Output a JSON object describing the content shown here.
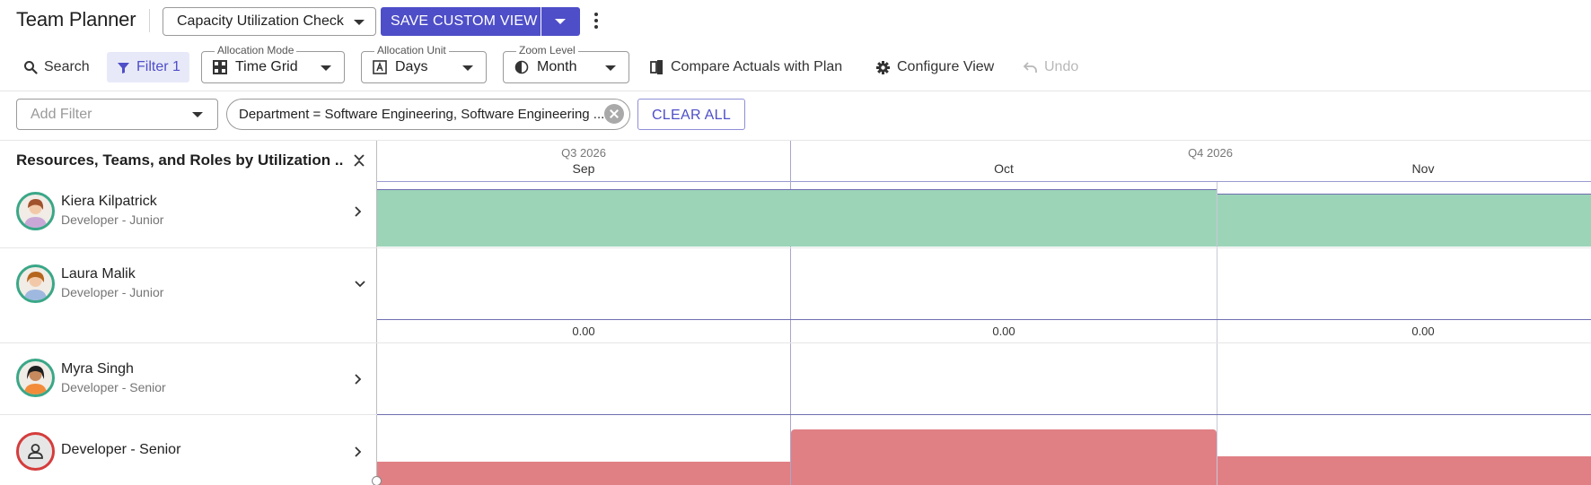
{
  "app": {
    "title": "Team Planner",
    "view_name": "Capacity Utilization Check",
    "save_label": "SAVE CUSTOM VIEW"
  },
  "toolbar": {
    "search_label": "Search",
    "filter_label": "Filter 1",
    "allocation_mode": {
      "label": "Allocation Mode",
      "value": "Time Grid"
    },
    "allocation_unit": {
      "label": "Allocation Unit",
      "value": "Days"
    },
    "zoom_level": {
      "label": "Zoom Level",
      "value": "Month"
    },
    "compare_label": "Compare Actuals with Plan",
    "configure_label": "Configure View",
    "undo_label": "Undo"
  },
  "filters": {
    "add_placeholder": "Add Filter",
    "chip_text": "Department = Software Engineering, Software Engineering ...",
    "clear_label": "CLEAR ALL"
  },
  "grid": {
    "left_header": "Resources, Teams, and Roles by Utilization ...",
    "quarters": [
      "Q3 2026",
      "Q4 2026"
    ],
    "months": [
      "Sep",
      "Oct",
      "Nov"
    ]
  },
  "resources": [
    {
      "name": "Kiera Kilpatrick",
      "role": "Developer - Junior",
      "expanded": false
    },
    {
      "name": "Laura Malik",
      "role": "Developer - Junior",
      "expanded": true,
      "values": [
        "0.00",
        "0.00",
        "0.00"
      ]
    },
    {
      "name": "Myra Singh",
      "role": "Developer - Senior",
      "expanded": false
    },
    {
      "name": "Developer - Senior",
      "role": "",
      "expanded": false
    }
  ],
  "colors": {
    "accent": "#4e4ec8",
    "allocation_ok": "#9cd4b8",
    "over_allocated": "#e08085",
    "avatar_ring_ok": "#3aa787",
    "avatar_ring_over": "#d53c3c"
  }
}
